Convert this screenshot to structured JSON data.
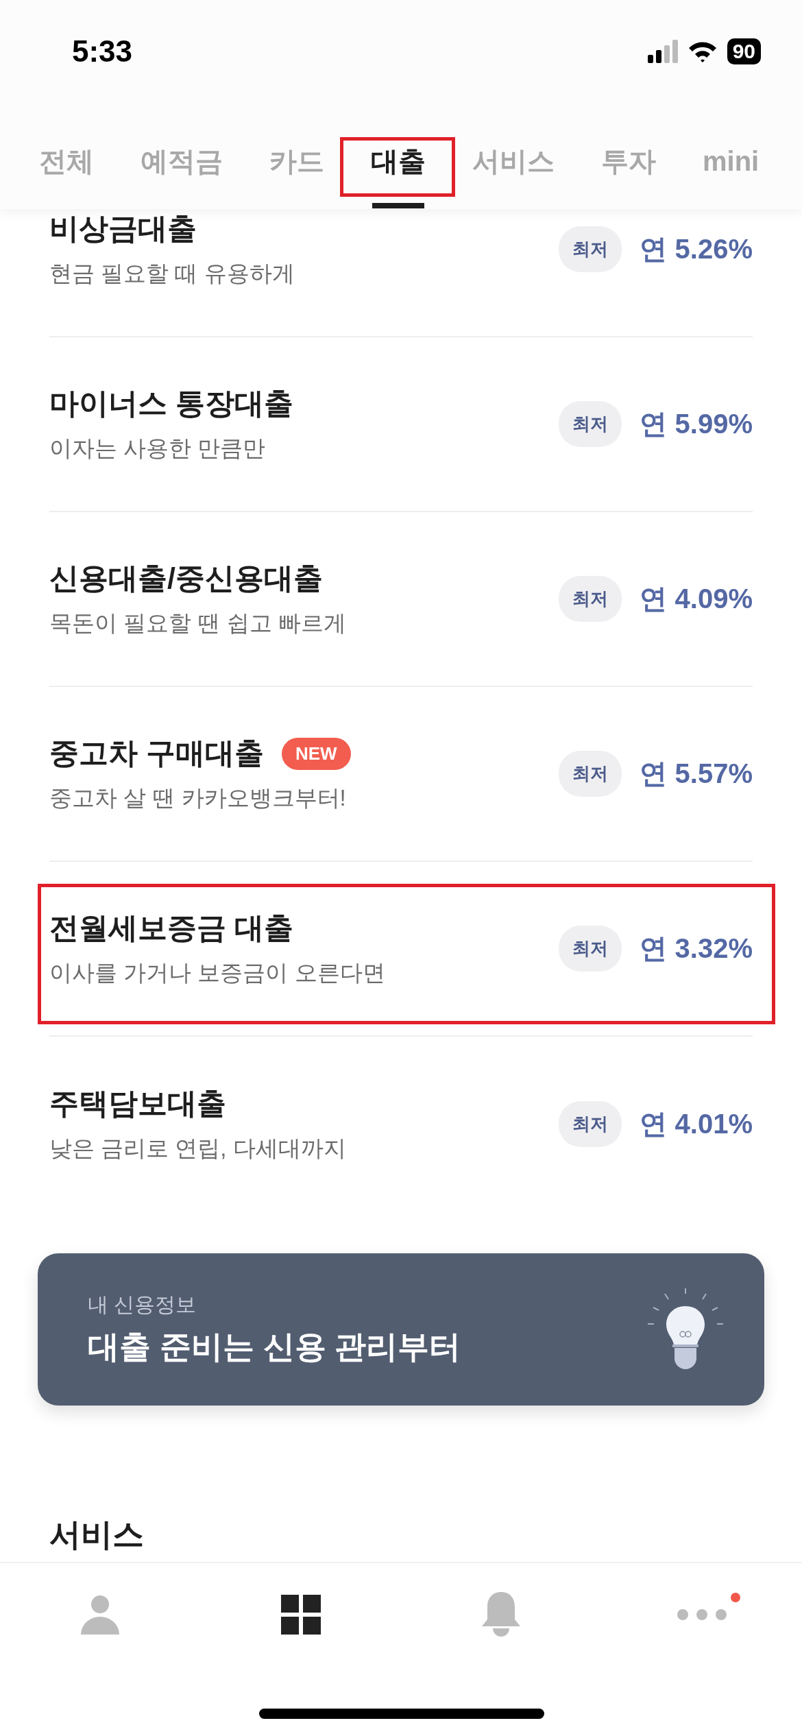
{
  "status_bar": {
    "time": "5:33",
    "battery": "90"
  },
  "tabs": [
    {
      "label": "전체",
      "selected": false,
      "highlighted": false
    },
    {
      "label": "예적금",
      "selected": false,
      "highlighted": false
    },
    {
      "label": "카드",
      "selected": false,
      "highlighted": false
    },
    {
      "label": "대출",
      "selected": true,
      "highlighted": true
    },
    {
      "label": "서비스",
      "selected": false,
      "highlighted": false
    },
    {
      "label": "투자",
      "selected": false,
      "highlighted": false
    },
    {
      "label": "mini",
      "selected": false,
      "highlighted": false
    }
  ],
  "loans": [
    {
      "title": "비상금대출",
      "subtitle": "현금 필요할 때 유용하게",
      "badge": "최저",
      "rate": "연 5.26%",
      "highlighted": false
    },
    {
      "title": "마이너스 통장대출",
      "subtitle": "이자는 사용한 만큼만",
      "badge": "최저",
      "rate": "연 5.99%",
      "highlighted": false
    },
    {
      "title": "신용대출/중신용대출",
      "subtitle": "목돈이 필요할 땐 쉽고 빠르게",
      "badge": "최저",
      "rate": "연 4.09%",
      "highlighted": false
    },
    {
      "title": "중고차 구매대출",
      "tag": "NEW",
      "subtitle": "중고차 살 땐 카카오뱅크부터!",
      "badge": "최저",
      "rate": "연 5.57%",
      "highlighted": false
    },
    {
      "title": "전월세보증금 대출",
      "subtitle": "이사를 가거나 보증금이 오른다면",
      "badge": "최저",
      "rate": "연 3.32%",
      "highlighted": true
    },
    {
      "title": "주택담보대출",
      "subtitle": "낮은 금리로 연립, 다세대까지",
      "badge": "최저",
      "rate": "연 4.01%",
      "highlighted": false
    }
  ],
  "banner": {
    "caption": "내 신용정보",
    "title": "대출 준비는 신용 관리부터"
  },
  "section_heading": "서비스",
  "bottom_nav": [
    {
      "kind": "profile",
      "selected": false,
      "dot": false
    },
    {
      "kind": "grid",
      "selected": true,
      "dot": false
    },
    {
      "kind": "bell",
      "selected": false,
      "dot": false
    },
    {
      "kind": "more",
      "selected": false,
      "dot": true
    }
  ]
}
